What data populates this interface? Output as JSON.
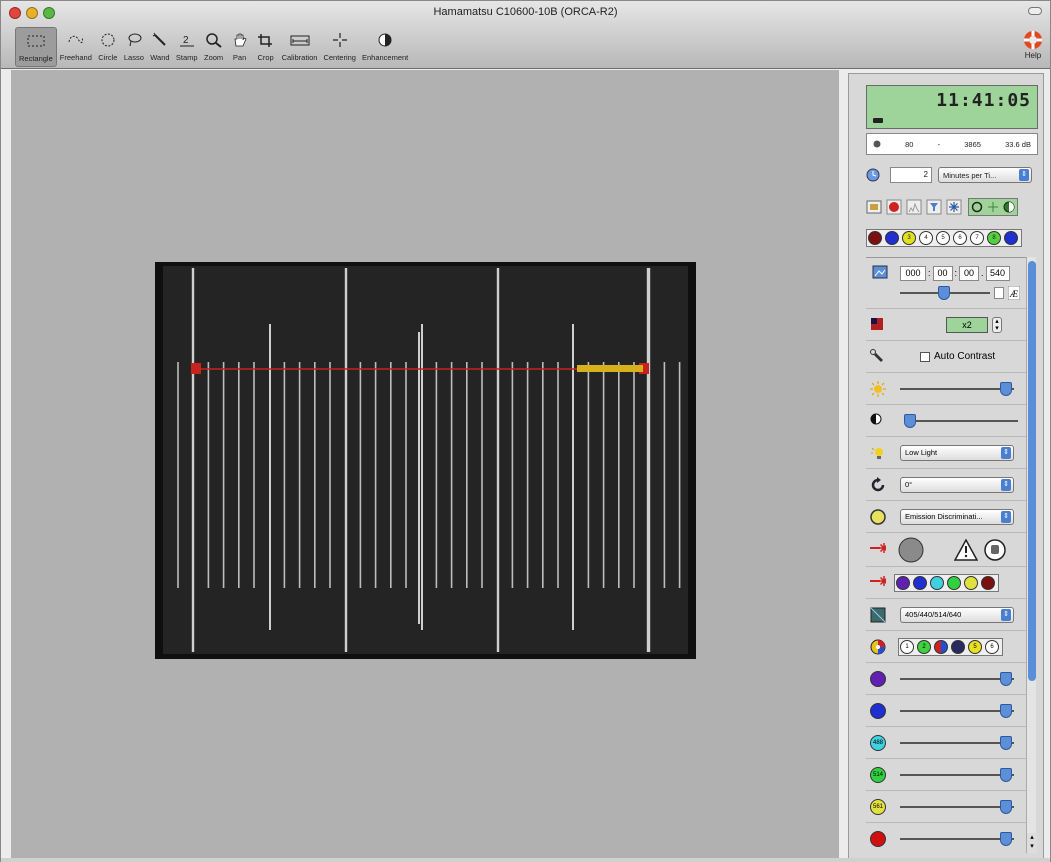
{
  "window": {
    "title": "Hamamatsu C10600-10B (ORCA-R2)"
  },
  "toolbar": {
    "tools": [
      {
        "label": "Rectangle",
        "icon": "rectangle-select-icon",
        "active": true
      },
      {
        "label": "Freehand",
        "icon": "freehand-icon"
      },
      {
        "label": "Circle",
        "icon": "circle-icon"
      },
      {
        "label": "Lasso",
        "icon": "lasso-icon"
      },
      {
        "label": "Wand",
        "icon": "wand-icon"
      },
      {
        "label": "Stamp",
        "icon": "stamp-icon"
      },
      {
        "label": "Zoom",
        "icon": "zoom-icon"
      },
      {
        "label": "Pan",
        "icon": "pan-icon"
      },
      {
        "label": "Crop",
        "icon": "crop-icon"
      },
      {
        "label": "Calibration",
        "icon": "calibration-icon"
      },
      {
        "label": "Centering",
        "icon": "centering-icon"
      },
      {
        "label": "Enhancement",
        "icon": "enhancement-icon"
      }
    ],
    "help_label": "Help"
  },
  "panel": {
    "clock": "11:41:05",
    "histogram": {
      "min": "80",
      "sep": "-",
      "max": "3865",
      "range": "33.6 dB"
    },
    "timelapse": {
      "value": "2",
      "unit": "Minutes per Ti..."
    },
    "exposure": {
      "h": "000",
      "m": "00",
      "s": "00",
      "ms": "540"
    },
    "binning": "x2",
    "auto_contrast_label": "Auto Contrast",
    "mode": "Low Light",
    "rotation": "0°",
    "filter": "Emission Discriminati...",
    "laser_lines": "405/440/514/640",
    "channel_labels": [
      "",
      "",
      "488",
      "514",
      "561",
      ""
    ]
  },
  "colors": {
    "clock_bg": "#9ed49a",
    "accent": "#5d8fd8",
    "scan_line": "#c8221e",
    "roi": "#d8b01c"
  }
}
